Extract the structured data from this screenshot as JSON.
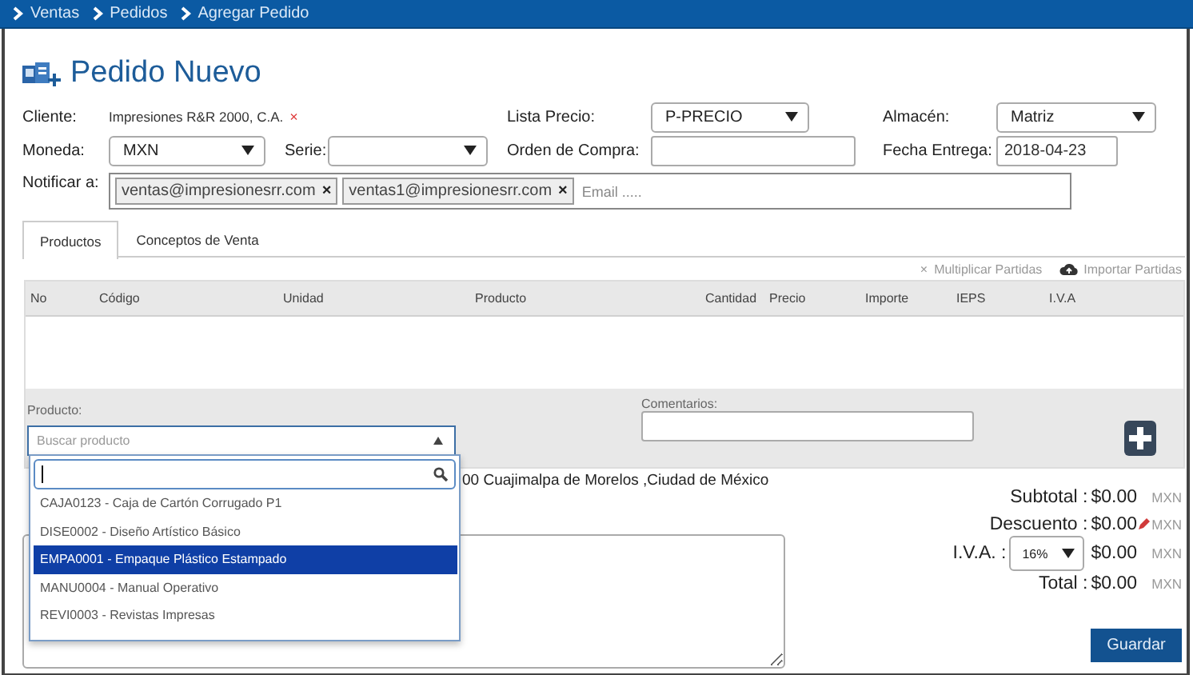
{
  "breadcrumb": [
    {
      "label": "Ventas"
    },
    {
      "label": "Pedidos"
    },
    {
      "label": "Agregar Pedido"
    }
  ],
  "title": "Pedido Nuevo",
  "form": {
    "cliente": {
      "label": "Cliente:",
      "value": "Impresiones R&R 2000, C.A.",
      "clear": "×"
    },
    "lista_precio": {
      "label": "Lista Precio:",
      "value": "P-PRECIO"
    },
    "almacen": {
      "label": "Almacén:",
      "value": "Matriz"
    },
    "moneda": {
      "label": "Moneda:",
      "value": "MXN"
    },
    "serie": {
      "label": "Serie:"
    },
    "orden_compra": {
      "label": "Orden de Compra:"
    },
    "fecha_entrega": {
      "label": "Fecha Entrega:",
      "value": "2018-04-23"
    },
    "notificar": {
      "label": "Notificar a:",
      "placeholder": "Email .....",
      "emails": [
        {
          "address": "ventas@impresionesrr.com",
          "remove": "×"
        },
        {
          "address": "ventas1@impresionesrr.com",
          "remove": "×"
        }
      ]
    }
  },
  "tabs": [
    {
      "label": "Productos",
      "selected": true
    },
    {
      "label": "Conceptos de Venta",
      "selected": false
    }
  ],
  "actions": [
    {
      "kind": "multiply",
      "symbol": "×",
      "label": "Multiplicar Partidas"
    },
    {
      "kind": "import",
      "label": "Importar Partidas"
    }
  ],
  "table": {
    "columns": [
      "No",
      "Código",
      "Unidad",
      "Producto",
      "Cantidad",
      "Precio",
      "Importe",
      "IEPS",
      "I.V.A"
    ]
  },
  "product_entry": {
    "product_label": "Producto:",
    "product_placeholder": "Buscar producto",
    "comments_label": "Comentarios:"
  },
  "product_dropdown": {
    "options": [
      {
        "label": "CAJA0123 - Caja de Cartón Corrugado P1",
        "selected": false
      },
      {
        "label": "DISE0002 - Diseño Artístico Básico",
        "selected": false
      },
      {
        "label": "EMPA0001 - Empaque Plástico Estampado",
        "selected": true
      },
      {
        "label": "MANU0004 - Manual Operativo",
        "selected": false
      },
      {
        "label": "REVI0003 - Revistas Impresas",
        "selected": false
      }
    ]
  },
  "address": {
    "text": "00 Cuajimalpa de Morelos ,Ciudad de México"
  },
  "totals": [
    {
      "kind": "plain",
      "label": "Subtotal :",
      "amount": "$0.00",
      "currency": "MXN"
    },
    {
      "kind": "discount",
      "label": "Descuento :",
      "amount": "$0.00",
      "currency": "MXN"
    },
    {
      "kind": "tax",
      "label": "I.V.A. :",
      "rate": "16%",
      "amount": "$0.00",
      "currency": "MXN"
    },
    {
      "kind": "plain",
      "label": "Total :",
      "amount": "$0.00",
      "currency": "MXN"
    }
  ],
  "save_button": "Guardar"
}
